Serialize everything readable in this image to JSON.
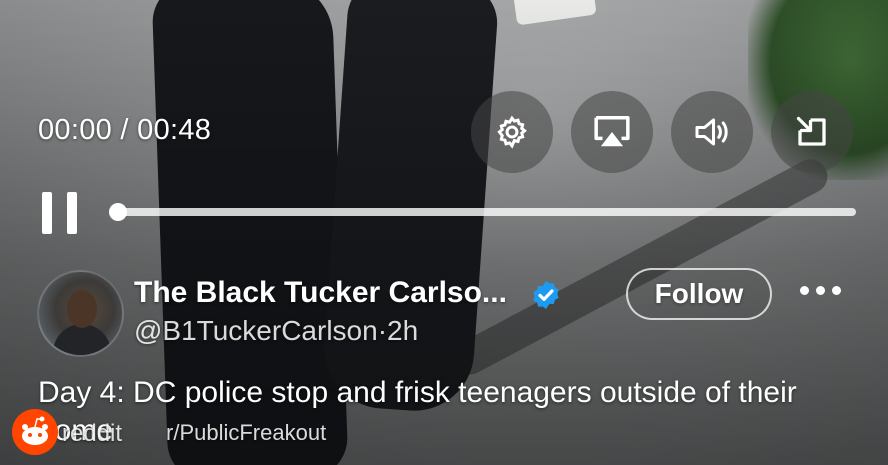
{
  "player": {
    "time_display": "00:00 / 00:48",
    "progress_fraction": 0.0,
    "controls": [
      {
        "icon": "settings-gear-icon"
      },
      {
        "icon": "airplay-icon"
      },
      {
        "icon": "volume-icon"
      },
      {
        "icon": "exit-fullscreen-icon"
      }
    ]
  },
  "post": {
    "display_name": "The Black Tucker Carlso...",
    "handle": "@B1TuckerCarlson",
    "separator": "·",
    "age": "2h",
    "follow_label": "Follow",
    "text": "Day 4: DC police stop and frisk teenagers outside of their home"
  },
  "watermark": {
    "brand": "reddit",
    "subreddit": "r/PublicFreakout"
  },
  "colors": {
    "verified": "#1d9bf0",
    "reddit": "#ff4500"
  }
}
